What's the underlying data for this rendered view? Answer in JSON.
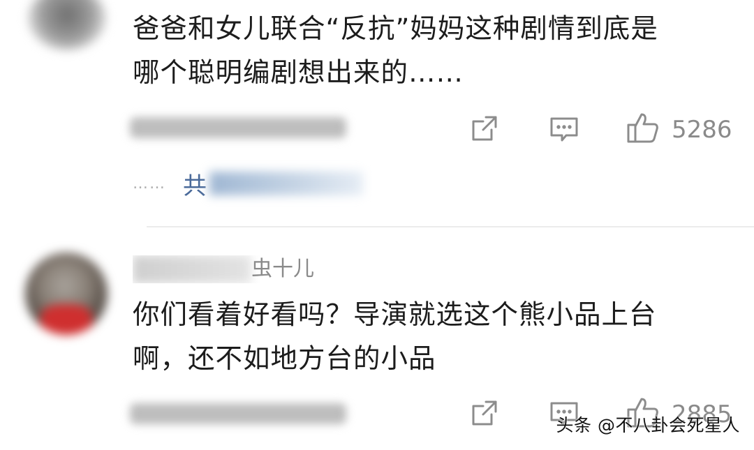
{
  "comments": [
    {
      "text_line1": "爸爸和女儿联合“反抗”妈妈这种剧情到底是",
      "text_line2": "哪个聪明编剧想出来的……",
      "likes": "5286",
      "replies_prefix": "共"
    },
    {
      "username_visible": "虫十儿",
      "text_line1": "你们看着好看吗？导演就选这个熊小品上台",
      "text_line2": "啊，还不如地方台的小品",
      "likes": "2885"
    }
  ],
  "ellipsis": "……",
  "watermark": "头条 @不八卦会死星人",
  "icons": {
    "share": "share-icon",
    "reply": "comment-icon",
    "like": "thumbs-up-icon"
  },
  "colors": {
    "link": "#4a6a9a",
    "meta": "#8a8a8a"
  }
}
